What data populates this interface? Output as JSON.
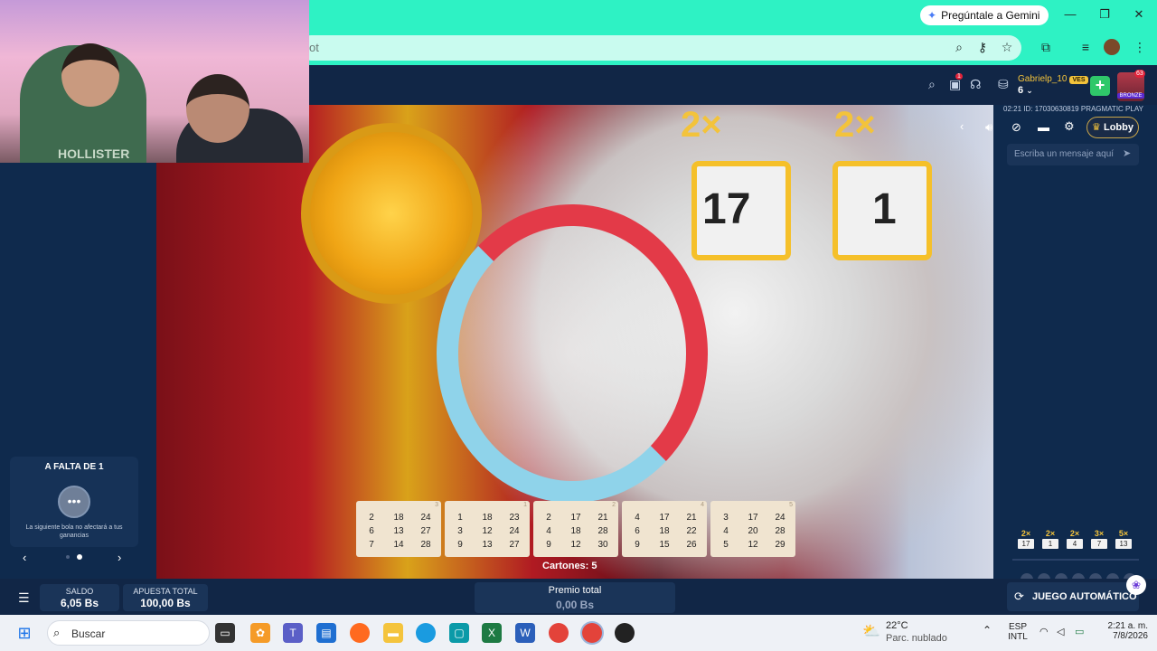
{
  "browser": {
    "gemini_label": "Pregúntale a Gemini",
    "url_fragment": "ot"
  },
  "game": {
    "user": {
      "name": "Gabrielp_10",
      "currency_badge": "VES",
      "level": "6"
    },
    "notif_count": "1",
    "bronze_count": "63",
    "bronze_label": "BRONZE",
    "stream_info": "02:21 ID: 17030630819 PRAGMATIC PLAY",
    "lobby_label": "Lobby",
    "chat_placeholder": "Escriba un mensaje aquí",
    "video_numbers": [
      "17",
      "1"
    ],
    "video_mults": [
      "2×",
      "2×"
    ],
    "cards": [
      {
        "index": "3",
        "rows": [
          [
            "2",
            "18",
            "24"
          ],
          [
            "6",
            "13",
            "27"
          ],
          [
            "7",
            "14",
            "28"
          ]
        ]
      },
      {
        "index": "1",
        "rows": [
          [
            "1",
            "18",
            "23"
          ],
          [
            "3",
            "12",
            "24"
          ],
          [
            "9",
            "13",
            "27"
          ]
        ]
      },
      {
        "index": "2",
        "rows": [
          [
            "2",
            "17",
            "21"
          ],
          [
            "4",
            "18",
            "28"
          ],
          [
            "9",
            "12",
            "30"
          ]
        ]
      },
      {
        "index": "4",
        "rows": [
          [
            "4",
            "17",
            "21"
          ],
          [
            "6",
            "18",
            "22"
          ],
          [
            "9",
            "15",
            "26"
          ]
        ]
      },
      {
        "index": "5",
        "rows": [
          [
            "3",
            "17",
            "24"
          ],
          [
            "4",
            "20",
            "28"
          ],
          [
            "5",
            "12",
            "29"
          ]
        ]
      }
    ],
    "cartones_label": "Cartones: 5",
    "falta": {
      "title": "A FALTA DE 1",
      "note": "La siguiente bola no afectará a tus ganancias"
    },
    "multipliers": [
      {
        "x": "2×",
        "n": "17"
      },
      {
        "x": "2×",
        "n": "1"
      },
      {
        "x": "2×",
        "n": "4"
      },
      {
        "x": "3×",
        "n": "7"
      },
      {
        "x": "5×",
        "n": "13"
      }
    ],
    "balls_drawn": "0",
    "balls_total": "/9",
    "saldo": {
      "label": "SALDO",
      "value": "6,05 Bs"
    },
    "apuesta": {
      "label": "APUESTA TOTAL",
      "value": "100,00 Bs"
    },
    "premio": {
      "label": "Premio total",
      "value": "0,00 Bs"
    },
    "auto_label": "JUEGO AUTOMÁTICO"
  },
  "webcam": {
    "shirt_text": "HOLLISTER"
  },
  "taskbar": {
    "search_placeholder": "Buscar",
    "weather_temp": "22°C",
    "weather_desc": "Parc. nublado",
    "lang_top": "ESP",
    "lang_bottom": "INTL",
    "time": "2:21 a. m.",
    "date": "7/8/2026"
  },
  "colors": {
    "teal": "#2ef2c4",
    "navy": "#0f2a4d",
    "gold": "#f3c33b",
    "red": "#e33a48"
  }
}
